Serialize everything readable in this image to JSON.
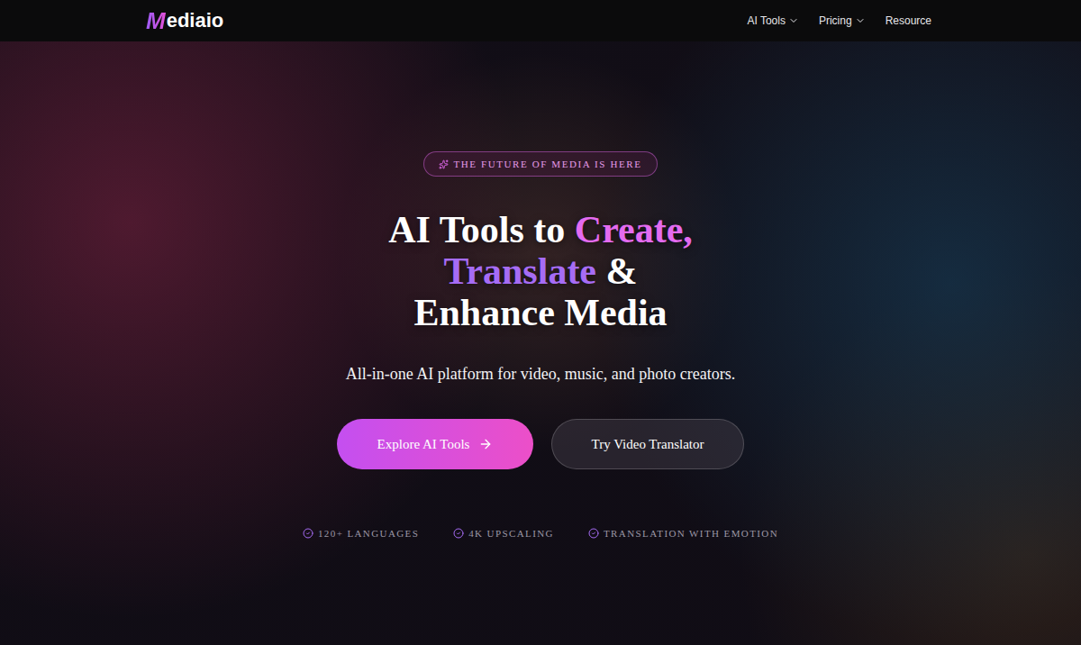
{
  "logo": {
    "mark": "M",
    "text": "ediaio"
  },
  "nav": {
    "items": [
      {
        "label": "AI Tools",
        "has_menu": true
      },
      {
        "label": "Pricing",
        "has_menu": true
      },
      {
        "label": "Resource",
        "has_menu": false
      }
    ]
  },
  "hero": {
    "badge": "THE FUTURE OF MEDIA IS HERE",
    "headline": [
      [
        {
          "text": "AI Tools to ",
          "color": "#ffffff"
        },
        {
          "text": "Create,",
          "color": "#e46bf0"
        }
      ],
      [
        {
          "text": "Translate",
          "color": "#a66cf5"
        },
        {
          "text": " &",
          "color": "#ffffff"
        }
      ],
      [
        {
          "text": "Enhance Media",
          "color": "#ffffff"
        }
      ]
    ],
    "subtitle": "All-in-one AI platform for video, music, and photo creators.",
    "buttons": [
      {
        "label": "Explore AI Tools",
        "kind": "primary"
      },
      {
        "label": "Try Video Translator",
        "kind": "secondary"
      }
    ],
    "features": [
      "120+ LANGUAGES",
      "4K UPSCALING",
      "TRANSLATION WITH EMOTION"
    ]
  }
}
